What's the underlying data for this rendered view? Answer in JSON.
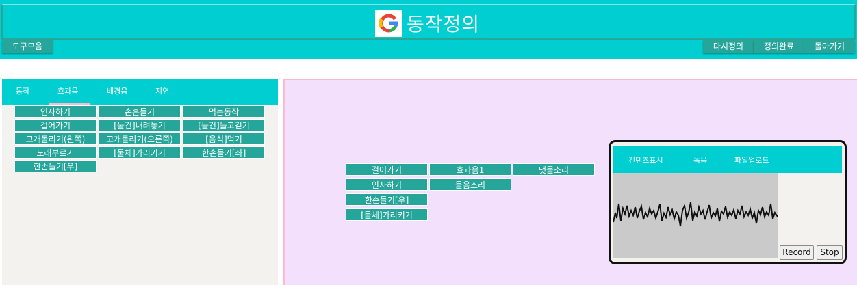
{
  "header": {
    "title": "동작정의",
    "logo_icon": "google-g-icon",
    "toolbox_label": "도구모음",
    "redefine_label": "다시정의",
    "done_label": "정의완료",
    "back_label": "돌아가기"
  },
  "left_tabs": [
    "동작",
    "효과음",
    "배경음",
    "지연"
  ],
  "actions": [
    [
      "인사하기",
      "손흔들기",
      "먹는동작"
    ],
    [
      "걸어가기",
      "[물건]내려놓기",
      "[물건]들고걷기"
    ],
    [
      "고개돌리기(왼쪽)",
      "고개돌리기(오른쪽)",
      "[음식]먹기"
    ],
    [
      "노래부르기",
      "[물체]가리키기",
      "한손들기[좌]"
    ],
    [
      "한손들기[우]"
    ]
  ],
  "sequence": [
    [
      "걸어가기",
      "효과음1",
      "냇물소리"
    ],
    [
      "인사하기",
      "물음소리"
    ],
    [
      "한손들기[우]"
    ],
    [
      "[물체]가리키기"
    ]
  ],
  "recorder": {
    "tabs": [
      "컨텐츠표시",
      "녹음",
      "파일업로드"
    ],
    "record_label": "Record",
    "stop_label": "Stop"
  },
  "colors": {
    "primary": "#00ced1",
    "button": "#26a69a",
    "canvas": "#f3e0fc",
    "accent": "#f8bbd0"
  }
}
